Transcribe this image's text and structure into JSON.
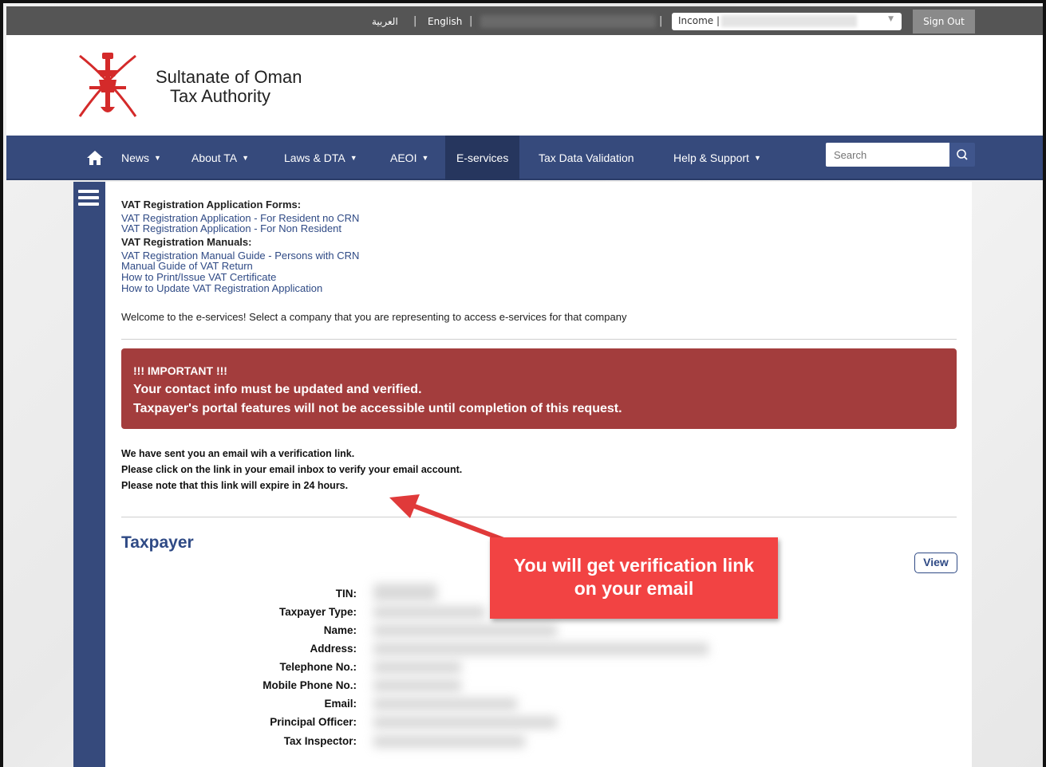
{
  "topbar": {
    "lang_arabic": "العربية",
    "lang_english": "English",
    "separator": "|",
    "income_label": "Income |",
    "signout_label": "Sign Out"
  },
  "header": {
    "brand_line1": "Sultanate of Oman",
    "brand_line2": "Tax Authority"
  },
  "nav": {
    "items": [
      {
        "label": "News",
        "has_dropdown": true
      },
      {
        "label": "About TA",
        "has_dropdown": true
      },
      {
        "label": "Laws & DTA",
        "has_dropdown": true
      },
      {
        "label": "AEOI",
        "has_dropdown": true
      },
      {
        "label": "E-services",
        "has_dropdown": false,
        "active": true
      },
      {
        "label": "Tax Data Validation",
        "has_dropdown": false
      },
      {
        "label": "Help & Support",
        "has_dropdown": true
      }
    ],
    "search_placeholder": "Search"
  },
  "content": {
    "forms_heading": "VAT Registration Application Forms:",
    "form_links": [
      "VAT Registration Application - For Resident no CRN",
      "VAT Registration Application - For Non Resident"
    ],
    "manuals_heading": "VAT Registration Manuals:",
    "manual_links": [
      "VAT Registration Manual Guide - Persons with CRN",
      "Manual Guide of VAT Return",
      "How to Print/Issue VAT Certificate",
      "How to Update VAT Registration Application"
    ],
    "welcome": "Welcome to the e-services! Select a company that you are representing to access e-services for that company",
    "alert": {
      "line1": "!!! IMPORTANT !!!",
      "line2": "Your contact info must be updated and verified.",
      "line3": "Taxpayer's portal features will not be accessible until completion of this request."
    },
    "email_msg": [
      "We have sent you an email wih a verification link.",
      "Please click on the link in your email inbox to verify your email account.",
      "Please note that this link will expire in 24 hours."
    ],
    "section_title": "Taxpayer",
    "view_label": "View",
    "fields": [
      "TIN:",
      "Taxpayer Type:",
      "Name:",
      "Address:",
      "Telephone No.:",
      "Mobile Phone No.:",
      "Email:",
      "Principal Officer:",
      "Tax Inspector:"
    ]
  },
  "annotation": {
    "line1": "You will get verification link",
    "line2": "on your email"
  },
  "colors": {
    "nav_bg": "#364a7c",
    "alert_bg": "#a33d3d",
    "link": "#2f4a85",
    "callout": "#f24343"
  }
}
